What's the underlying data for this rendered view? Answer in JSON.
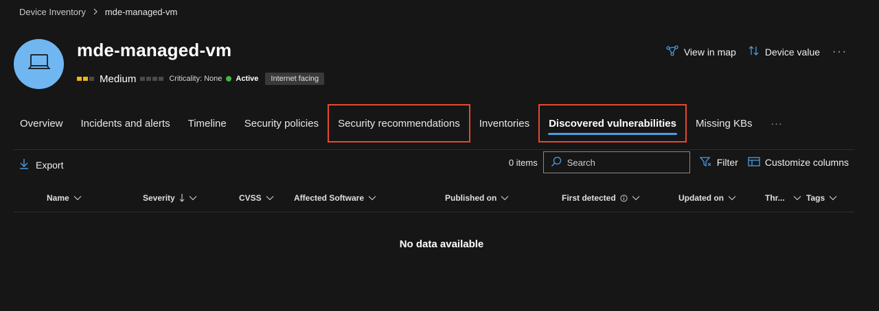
{
  "breadcrumb": {
    "parent": "Device Inventory",
    "current": "mde-managed-vm"
  },
  "device": {
    "name": "mde-managed-vm",
    "avatar_icon": "laptop-icon",
    "risk_level": "Medium",
    "criticality": "Criticality: None",
    "status": "Active",
    "tag": "Internet facing"
  },
  "actions": {
    "view_in_map": "View in map",
    "device_value": "Device value",
    "more": "···"
  },
  "tabs": [
    {
      "label": "Overview"
    },
    {
      "label": "Incidents and alerts"
    },
    {
      "label": "Timeline"
    },
    {
      "label": "Security policies"
    },
    {
      "label": "Security recommendations"
    },
    {
      "label": "Inventories"
    },
    {
      "label": "Discovered vulnerabilities"
    },
    {
      "label": "Missing KBs"
    }
  ],
  "tabs_more": "···",
  "toolbar": {
    "export": "Export",
    "items_count": "0 items",
    "search_placeholder": "Search",
    "filter": "Filter",
    "customize_columns": "Customize columns"
  },
  "columns": [
    {
      "label": "Name"
    },
    {
      "label": "Severity"
    },
    {
      "label": "CVSS"
    },
    {
      "label": "Affected Software"
    },
    {
      "label": "Published on"
    },
    {
      "label": "First detected"
    },
    {
      "label": "Updated on"
    },
    {
      "label": "Thr..."
    },
    {
      "label": "Tags"
    }
  ],
  "empty_message": "No data available",
  "colors": {
    "background": "#161616",
    "accent": "#4a9fe8",
    "highlight_box": "#e8492d",
    "severity_medium": "#f2b40f",
    "status_active": "#3fba3f",
    "avatar": "#70b7f2"
  }
}
